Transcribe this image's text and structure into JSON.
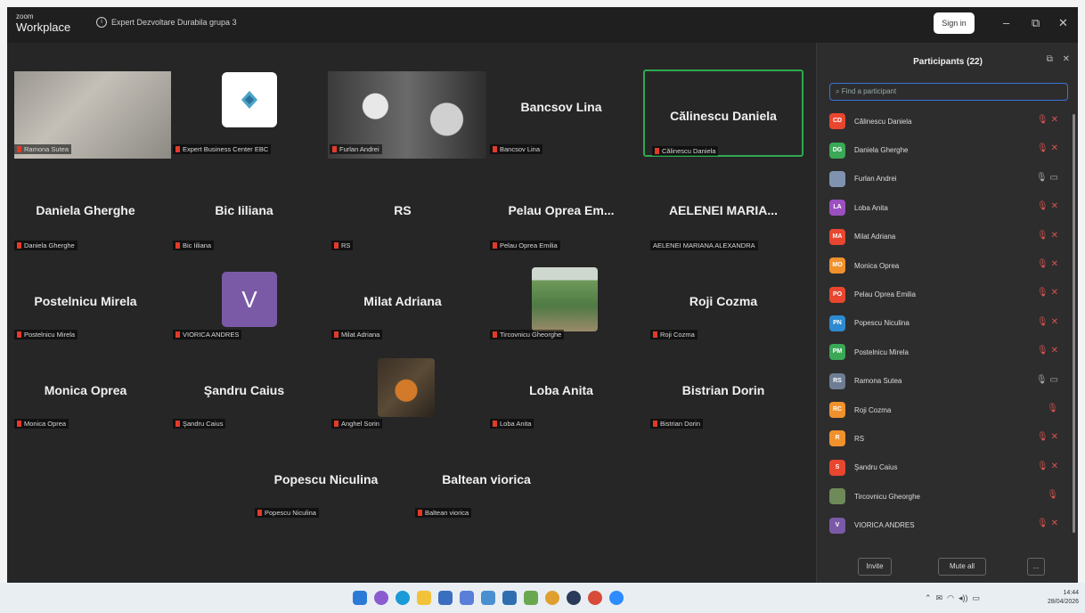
{
  "title_bar": {
    "brand_small": "zoom",
    "brand_big": "Workplace",
    "meeting_title": "Expert Dezvoltare Durabila grupa 3",
    "sign_in": "Sign in",
    "minimize": "–",
    "maximize": "⧉",
    "close": "✕"
  },
  "gallery": {
    "row1": [
      {
        "label": "Ramona Sutea"
      },
      {
        "label": "Expert Business Center EBC"
      },
      {
        "label": "Furlan Andrei"
      },
      {
        "name": "Bancsov  Lina",
        "label": "Bancsov  Lina"
      },
      {
        "name": "Călinescu Daniela",
        "label": "Călinescu Daniela"
      }
    ],
    "row2": [
      {
        "name": "Daniela Gherghe",
        "label": "Daniela Gherghe"
      },
      {
        "name": "Bic Iiliana",
        "label": "Bic Iiliana"
      },
      {
        "name": "RS",
        "label": "RS"
      },
      {
        "name": "Pelau Oprea Em...",
        "label": "Pelau Oprea Emilia"
      },
      {
        "name": "AELENEI  MARIA...",
        "label": "AELENEI MARIANA ALEXANDRA"
      }
    ],
    "row3": [
      {
        "name": "Postelnicu Mirela",
        "label": "Postelnicu Mirela"
      },
      {
        "avatar": "V",
        "label": "VIORICA ANDRES"
      },
      {
        "name": "Milat Adriana",
        "label": "Milat Adriana"
      },
      {
        "label": "Tircovnicu Gheorghe"
      },
      {
        "name": "Roji Cozma",
        "label": "Roji Cozma"
      }
    ],
    "row4": [
      {
        "name": "Monica Oprea",
        "label": "Monica Oprea"
      },
      {
        "name": "Şandru Caius",
        "label": "Şandru Caius"
      },
      {
        "label": "Anghel Sorin"
      },
      {
        "name": "Loba Anita",
        "label": "Loba Anita"
      },
      {
        "name": "Bistrian Dorin",
        "label": "Bistrian Dorin"
      }
    ],
    "row5": [
      {
        "name": "Popescu Niculina",
        "label": "Popescu Niculina"
      },
      {
        "name": "Baltean viorica",
        "label": "Baltean viorica"
      }
    ]
  },
  "participants": {
    "title": "Participants (22)",
    "search_placeholder": "Find a participant",
    "items": [
      {
        "initials": "CD",
        "name": "Călinescu Daniela",
        "color": "#e8462f"
      },
      {
        "initials": "DG",
        "name": "Daniela Gherghe",
        "color": "#3aa856"
      },
      {
        "initials": "",
        "name": "Furlan Andrei",
        "color": "#7f93b0"
      },
      {
        "initials": "LA",
        "name": "Loba Anita",
        "color": "#9b4fc0"
      },
      {
        "initials": "MA",
        "name": "Milat Adriana",
        "color": "#e8462f"
      },
      {
        "initials": "MO",
        "name": "Monica Oprea",
        "color": "#f0912d"
      },
      {
        "initials": "PO",
        "name": "Pelau Oprea Emilia",
        "color": "#e8462f"
      },
      {
        "initials": "PN",
        "name": "Popescu Niculina",
        "color": "#2d8ad0"
      },
      {
        "initials": "PM",
        "name": "Postelnicu Mirela",
        "color": "#3aa856"
      },
      {
        "initials": "RS",
        "name": "Ramona Sutea",
        "color": "#6d7d93"
      },
      {
        "initials": "RC",
        "name": "Roji Cozma",
        "color": "#f0912d"
      },
      {
        "initials": "R",
        "name": "RS",
        "color": "#f0912d"
      },
      {
        "initials": "S",
        "name": "Şandru Caius",
        "color": "#e8462f"
      },
      {
        "initials": "",
        "name": "Tircovnicu Gheorghe",
        "color": "#6e8a58"
      },
      {
        "initials": "V",
        "name": "VIORICA ANDRES",
        "color": "#7a5aa6"
      }
    ],
    "invite": "Invite",
    "mute_all": "Mute all",
    "more": "..."
  },
  "taskbar": {
    "time": "14:44",
    "date": "28/04/2026"
  }
}
